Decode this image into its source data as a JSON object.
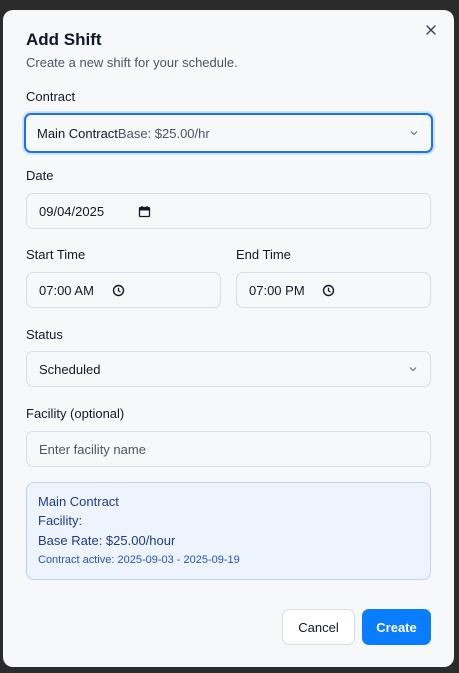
{
  "dialog": {
    "title": "Add Shift",
    "subtitle": "Create a new shift for your schedule.",
    "close_icon": "close-icon"
  },
  "form": {
    "contract": {
      "label": "Contract",
      "selected_name": "Main Contract",
      "selected_detail": "Base: $25.00/hr"
    },
    "date": {
      "label": "Date",
      "value": "09/04/2025",
      "icon": "calendar-icon"
    },
    "start_time": {
      "label": "Start Time",
      "value": "07:00 AM",
      "icon": "clock-icon"
    },
    "end_time": {
      "label": "End Time",
      "value": "07:00 PM",
      "icon": "clock-icon"
    },
    "status": {
      "label": "Status",
      "value": "Scheduled"
    },
    "facility": {
      "label": "Facility (optional)",
      "value": "",
      "placeholder": "Enter facility name"
    }
  },
  "summary": {
    "contract_name": "Main Contract",
    "facility_line": "Facility:",
    "base_rate": "Base Rate: $25.00/hour",
    "contract_active": "Contract active: 2025-09-03 - 2025-09-19"
  },
  "actions": {
    "cancel_label": "Cancel",
    "create_label": "Create"
  },
  "colors": {
    "accent": "#0a7cff",
    "focus_border": "#1a73e8",
    "info_bg": "#eef4fd",
    "info_text": "#1e3a8a"
  }
}
